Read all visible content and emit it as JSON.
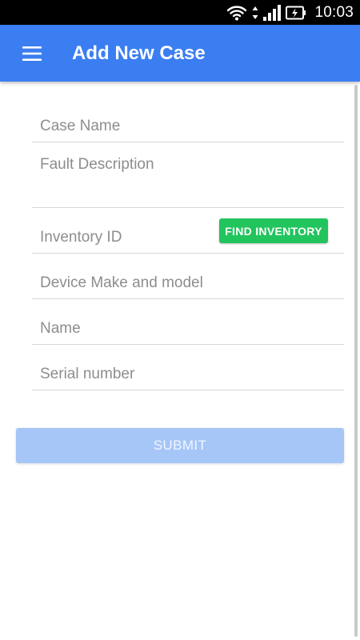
{
  "status_bar": {
    "time": "10:03",
    "icons": [
      "wifi-icon",
      "data-arrows-icon",
      "signal-icon",
      "battery-charging-icon"
    ]
  },
  "app_bar": {
    "menu_icon": "menu-icon",
    "title": "Add New Case",
    "color": "#3a7ef1"
  },
  "form": {
    "case_name": {
      "value": "",
      "placeholder": "Case Name"
    },
    "fault_description": {
      "value": "",
      "placeholder": "Fault Description"
    },
    "inventory_id": {
      "value": "",
      "placeholder": "Inventory ID"
    },
    "find_inventory_label": "FIND INVENTORY",
    "device_make_model": {
      "value": "",
      "placeholder": "Device Make and model"
    },
    "name": {
      "value": "",
      "placeholder": "Name"
    },
    "serial_number": {
      "value": "",
      "placeholder": "Serial number"
    },
    "submit_label": "SUBMIT"
  },
  "colors": {
    "find_button": "#22c45e",
    "submit_button_disabled": "#a6c6f8"
  }
}
